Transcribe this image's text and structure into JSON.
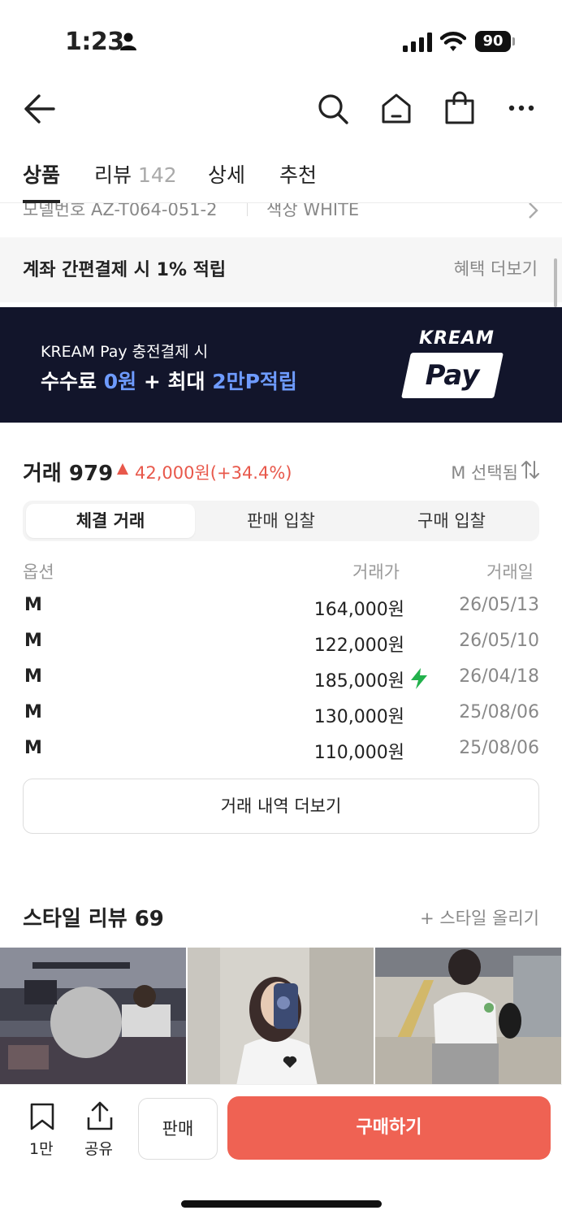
{
  "status_bar": {
    "time": "1:23",
    "battery": "90"
  },
  "tabs": [
    {
      "label": "상품",
      "count": ""
    },
    {
      "label": "리뷰",
      "count": "142"
    },
    {
      "label": "상세",
      "count": ""
    },
    {
      "label": "추천",
      "count": ""
    }
  ],
  "product_meta": {
    "model": "모델번호 AZ-T064-051-2",
    "color": "색상 WHITE"
  },
  "benefit": {
    "text": "계좌 간편결제 시 1% 적립",
    "link": "혜택 더보기"
  },
  "banner": {
    "sub": "KREAM Pay 충전결제 시",
    "main_a": "수수료 ",
    "main_hl1": "0원",
    "main_b": " + 최대 ",
    "main_hl2": "2만P적립",
    "logo_top": "KREAM",
    "logo_bottom": "Pay"
  },
  "trade": {
    "title": "거래 979",
    "change": "42,000원(+34.4%)",
    "size_selected": "M 선택됨",
    "segments": [
      "체결 거래",
      "판매 입찰",
      "구매 입찰"
    ],
    "columns": [
      "옵션",
      "거래가",
      "거래일"
    ],
    "rows": [
      {
        "option": "M",
        "price": "164,000원",
        "date": "26/05/13",
        "fast": false
      },
      {
        "option": "M",
        "price": "122,000원",
        "date": "26/05/10",
        "fast": false
      },
      {
        "option": "M",
        "price": "185,000원",
        "date": "26/04/18",
        "fast": true
      },
      {
        "option": "M",
        "price": "130,000원",
        "date": "25/08/06",
        "fast": false
      },
      {
        "option": "M",
        "price": "110,000원",
        "date": "25/08/06",
        "fast": false
      }
    ],
    "more": "거래 내역 더보기"
  },
  "style_review": {
    "title": "스타일 리뷰 69",
    "upload": "+ 스타일 올리기"
  },
  "bottom_bar": {
    "bookmark_count": "1만",
    "share": "공유",
    "sell": "판매",
    "buy": "구매하기"
  },
  "colors": {
    "accent_red": "#ef6253",
    "up_red": "#e8584b",
    "banner_bg": "#12152b",
    "banner_highlight": "#6e9bff",
    "fast_green": "#22b14c"
  }
}
